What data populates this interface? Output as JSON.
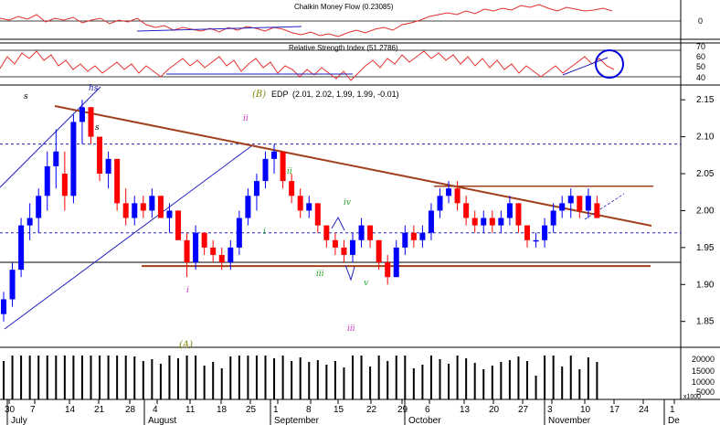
{
  "chart_data": {
    "type": "candlestick",
    "instrument_label": "EDP",
    "ohlc_readout": "(2.01, 2.02, 1.99, 1.99, -0.01)",
    "price_axis": {
      "ticks": [
        2.15,
        2.1,
        2.05,
        2.0,
        1.95,
        1.9,
        1.85
      ],
      "range": [
        1.815,
        2.17
      ]
    },
    "date_axis": {
      "day_ticks": [
        "30",
        "7",
        "14",
        "21",
        "28",
        "4",
        "11",
        "18",
        "25",
        "1",
        "8",
        "15",
        "22",
        "29",
        "6",
        "13",
        "20",
        "27",
        "3",
        "10",
        "17",
        "24",
        "1"
      ],
      "month_labels": [
        "July",
        "August",
        "September",
        "October",
        "November",
        "De"
      ]
    },
    "colors": {
      "up": "#0000ff",
      "down": "#ff0000",
      "trendline": "#a0401c",
      "channel": "#2020c0",
      "wave_green": "#20a020",
      "wave_purple": "#cc33cc",
      "wave_olive": "#808000",
      "indicator": "#e03030"
    },
    "chaikin": {
      "title": "Chaikin Money Flow (0.23085)",
      "ticks": [
        "0"
      ]
    },
    "rsi": {
      "title": "Relative Strength Index (51.2786)",
      "ticks": [
        "70",
        "60",
        "50",
        "40"
      ]
    },
    "volume": {
      "ticks": [
        "20000",
        "15000",
        "10000",
        "5000"
      ],
      "multiplier": "x1000"
    },
    "reference_levels": [
      2.09,
      1.97,
      1.93
    ],
    "support_level": 1.925,
    "resistance_level": 2.033,
    "wave_labels": {
      "B": "(B)",
      "A": "(A)",
      "s1": "s",
      "s2": "s",
      "hs": "hs",
      "ii_top": "ii",
      "ii_green": "ii",
      "i_green": "i",
      "i_purple": "i",
      "iv": "iv",
      "iii_green": "iii",
      "iii_purple": "iii",
      "v": "v"
    },
    "series": [
      {
        "name": "price",
        "values": [
          [
            1.86,
            1.89,
            1.85,
            1.88
          ],
          [
            1.88,
            1.93,
            1.87,
            1.92
          ],
          [
            1.92,
            1.99,
            1.91,
            1.98
          ],
          [
            1.98,
            2.01,
            1.96,
            1.99
          ],
          [
            1.99,
            2.03,
            1.97,
            2.02
          ],
          [
            2.02,
            2.08,
            2.0,
            2.06
          ],
          [
            2.06,
            2.11,
            2.03,
            2.08
          ],
          [
            2.05,
            2.08,
            2.0,
            2.02
          ],
          [
            2.02,
            2.13,
            2.01,
            2.12
          ],
          [
            2.12,
            2.15,
            2.09,
            2.14
          ],
          [
            2.14,
            2.14,
            2.09,
            2.1
          ],
          [
            2.1,
            2.1,
            2.04,
            2.05
          ],
          [
            2.05,
            2.08,
            2.03,
            2.07
          ],
          [
            2.07,
            2.07,
            2.0,
            2.01
          ],
          [
            2.01,
            2.03,
            1.98,
            1.99
          ],
          [
            1.99,
            2.02,
            1.98,
            2.01
          ],
          [
            2.01,
            2.02,
            1.99,
            2.0
          ],
          [
            2.0,
            2.03,
            1.99,
            2.02
          ],
          [
            2.02,
            2.02,
            1.99,
            1.99
          ],
          [
            1.99,
            2.01,
            1.97,
            2.0
          ],
          [
            2.0,
            2.0,
            1.96,
            1.96
          ],
          [
            1.96,
            1.97,
            1.91,
            1.93
          ],
          [
            1.93,
            1.98,
            1.92,
            1.97
          ],
          [
            1.97,
            1.97,
            1.94,
            1.95
          ],
          [
            1.95,
            1.96,
            1.93,
            1.94
          ],
          [
            1.94,
            1.95,
            1.92,
            1.93
          ],
          [
            1.93,
            1.96,
            1.92,
            1.95
          ],
          [
            1.95,
            2.0,
            1.94,
            1.99
          ],
          [
            1.99,
            2.03,
            1.98,
            2.02
          ],
          [
            2.02,
            2.05,
            2.0,
            2.04
          ],
          [
            2.04,
            2.08,
            2.03,
            2.07
          ],
          [
            2.07,
            2.09,
            2.05,
            2.08
          ],
          [
            2.08,
            2.08,
            2.03,
            2.04
          ],
          [
            2.04,
            2.05,
            2.01,
            2.02
          ],
          [
            2.02,
            2.03,
            1.99,
            2.0
          ],
          [
            2.0,
            2.02,
            1.99,
            2.01
          ],
          [
            2.01,
            2.01,
            1.97,
            1.98
          ],
          [
            1.98,
            1.98,
            1.95,
            1.96
          ],
          [
            1.96,
            1.97,
            1.94,
            1.95
          ],
          [
            1.95,
            1.96,
            1.93,
            1.94
          ],
          [
            1.94,
            1.97,
            1.93,
            1.96
          ],
          [
            1.96,
            1.99,
            1.95,
            1.98
          ],
          [
            1.98,
            1.98,
            1.95,
            1.96
          ],
          [
            1.96,
            1.96,
            1.92,
            1.93
          ],
          [
            1.93,
            1.94,
            1.9,
            1.91
          ],
          [
            1.91,
            1.96,
            1.91,
            1.95
          ],
          [
            1.95,
            1.98,
            1.94,
            1.97
          ],
          [
            1.97,
            1.98,
            1.95,
            1.96
          ],
          [
            1.96,
            1.98,
            1.95,
            1.97
          ],
          [
            1.97,
            2.01,
            1.96,
            2.0
          ],
          [
            2.0,
            2.03,
            1.99,
            2.02
          ],
          [
            2.02,
            2.04,
            2.01,
            2.03
          ],
          [
            2.03,
            2.04,
            2.0,
            2.01
          ],
          [
            2.01,
            2.02,
            1.98,
            1.99
          ],
          [
            1.99,
            2.0,
            1.97,
            1.98
          ],
          [
            1.98,
            2.0,
            1.97,
            1.99
          ],
          [
            1.99,
            2.0,
            1.97,
            1.98
          ],
          [
            1.98,
            2.0,
            1.97,
            1.99
          ],
          [
            1.99,
            2.02,
            1.98,
            2.01
          ],
          [
            2.01,
            2.01,
            1.97,
            1.98
          ],
          [
            1.98,
            1.98,
            1.95,
            1.96
          ],
          [
            1.96,
            1.97,
            1.95,
            1.96
          ],
          [
            1.96,
            1.99,
            1.95,
            1.98
          ],
          [
            1.98,
            2.01,
            1.97,
            2.0
          ],
          [
            2.0,
            2.02,
            1.99,
            2.01
          ],
          [
            2.01,
            2.03,
            1.99,
            2.02
          ],
          [
            2.02,
            2.02,
            1.99,
            2.0
          ],
          [
            2.0,
            2.03,
            1.99,
            2.02
          ],
          [
            2.01,
            2.02,
            1.99,
            1.99
          ]
        ]
      }
    ]
  }
}
